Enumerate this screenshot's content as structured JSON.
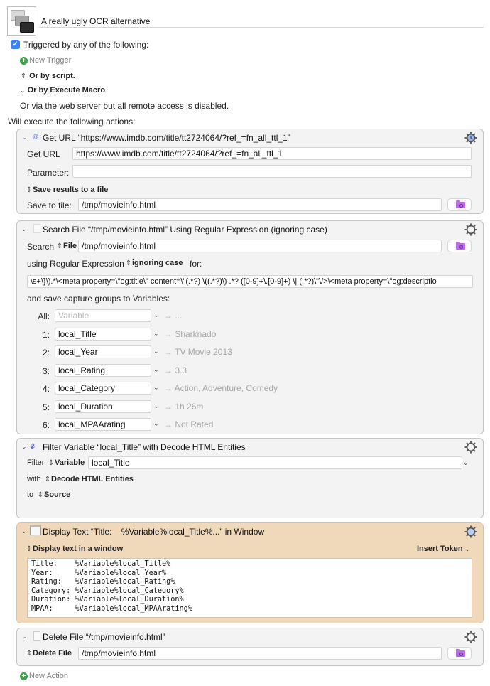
{
  "macro": {
    "name": "A really ugly OCR alternative",
    "icon": "windows-stack-icon"
  },
  "triggers": {
    "enabled": true,
    "label": "Triggered by any of the following:",
    "new_trigger": "New Trigger",
    "or_by_script": "Or by script.",
    "or_by_execute_macro": "Or by Execute Macro",
    "web_server_note": "Or via the web server but all remote access is disabled."
  },
  "actions_header": "Will execute the following actions:",
  "actions": {
    "get_url": {
      "title": "Get URL “https://www.imdb.com/title/tt2724064/?ref_=fn_all_ttl_1”",
      "icon": "url-at-icon",
      "get_url_label": "Get URL",
      "url_value": "https://www.imdb.com/title/tt2724064/?ref_=fn_all_ttl_1",
      "parameter_label": "Parameter:",
      "parameter_value": "",
      "save_mode": "Save results to a file",
      "save_to_label": "Save to file:",
      "save_to_value": "/tmp/movieinfo.html"
    },
    "search_file": {
      "title": "Search File “/tmp/movieinfo.html” Using Regular Expression (ignoring case)",
      "icon": "document-icon",
      "search_label": "Search",
      "source_type": "File",
      "file_value": "/tmp/movieinfo.html",
      "using_label": "using Regular Expression",
      "case_mode": "ignoring case",
      "for_label": "for:",
      "regex": "\\s+\\}\\).*\\<meta property=\\\"og:title\\\" content=\\\"(.*?) \\((.*?)\\) .*? ([0-9]+\\.[0-9]+) \\| (.*?)\\\"\\/>\\<meta property=\\\"og:descriptio",
      "save_label": "and save capture groups to Variables:",
      "variables": [
        {
          "index": "All:",
          "name": "",
          "placeholder": "Variable",
          "result": "→ ..."
        },
        {
          "index": "1:",
          "name": "local_Title",
          "placeholder": "",
          "result": "→ Sharknado"
        },
        {
          "index": "2:",
          "name": "local_Year",
          "placeholder": "",
          "result": "→ TV Movie 2013"
        },
        {
          "index": "3:",
          "name": "local_Rating",
          "placeholder": "",
          "result": "→ 3.3"
        },
        {
          "index": "4:",
          "name": "local_Category",
          "placeholder": "",
          "result": "→ Action, Adventure, Comedy"
        },
        {
          "index": "5:",
          "name": "local_Duration",
          "placeholder": "",
          "result": "→ 1h 26m"
        },
        {
          "index": "6:",
          "name": "local_MPAArating",
          "placeholder": "",
          "result": "→ Not Rated"
        }
      ]
    },
    "filter_variable": {
      "title": "Filter Variable “local_Title” with Decode HTML Entities",
      "icon": "variable-x-icon",
      "filter_label": "Filter",
      "filter_type": "Variable",
      "variable_value": "local_Title",
      "with_label": "with",
      "filter_mode": "Decode HTML Entities",
      "to_label": "to",
      "to_value": "Source"
    },
    "display_text": {
      "title": "Display Text “Title:    %Variable%local_Title%...” in Window",
      "icon": "window-icon",
      "mode": "Display text in a window",
      "insert_token": "Insert Token",
      "lines": [
        "Title:    %Variable%local_Title%",
        "Year:     %Variable%local_Year%",
        "Rating:   %Variable%local_Rating%",
        "Category: %Variable%local_Category%",
        "Duration: %Variable%local_Duration%",
        "MPAA:     %Variable%local_MPAArating%"
      ]
    },
    "delete_file": {
      "title": "Delete File “/tmp/movieinfo.html”",
      "icon": "document-icon",
      "mode": "Delete File",
      "file_value": "/tmp/movieinfo.html"
    }
  },
  "new_action": "New Action",
  "colors": {
    "accent_blue": "#3b82f6",
    "add_green": "#3fa34d",
    "folder_purple": "#b86ee0",
    "display_text_bg": "#f0d8bb",
    "action_bg": "#f3f3f3"
  }
}
